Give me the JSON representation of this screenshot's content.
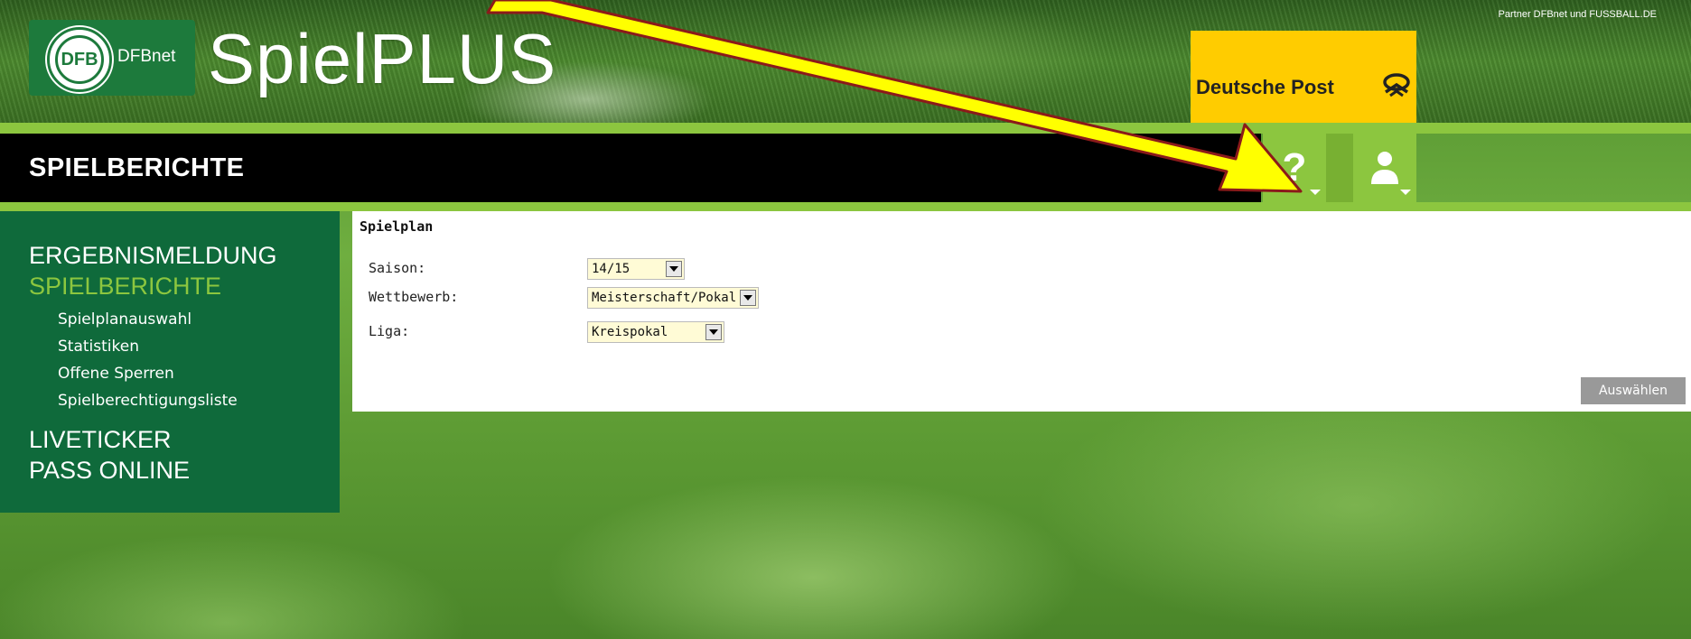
{
  "header": {
    "logo_text": "DFBnet",
    "logo_emblem": "DFB",
    "app_title": "SpielPLUS",
    "partner_text": "Partner DFBnet und FUSSBALL.DE",
    "sponsor_label": "Deutsche Post",
    "sponsor_icon": "posthorn-icon",
    "sponsor_color": "#ffcc00"
  },
  "title_bar": {
    "title": "SPIELBERICHTE",
    "help_glyph": "?",
    "help_icon": "question-mark-icon",
    "user_icon": "user-icon"
  },
  "sidebar": {
    "items": [
      {
        "label": "ERGEBNISMELDUNG",
        "active": false
      },
      {
        "label": "SPIELBERICHTE",
        "active": true
      },
      {
        "label": "LIVETICKER",
        "active": false
      },
      {
        "label": "PASS ONLINE",
        "active": false
      }
    ],
    "subitems": [
      {
        "label": "Spielplanauswahl"
      },
      {
        "label": "Statistiken"
      },
      {
        "label": "Offene Sperren"
      },
      {
        "label": "Spielberechtigungsliste"
      }
    ]
  },
  "panel": {
    "title": "Spielplan",
    "fields": [
      {
        "label": "Saison:",
        "value": "14/15"
      },
      {
        "label": "Wettbewerb:",
        "value": "Meisterschaft/Pokal"
      },
      {
        "label": "Liga:",
        "value": "Kreispokal"
      }
    ],
    "submit_label": "Auswählen"
  },
  "colors": {
    "accent_green": "#8cc63f",
    "sidebar_green": "#0f6a3b",
    "annotation_arrow": "#ffff00"
  }
}
